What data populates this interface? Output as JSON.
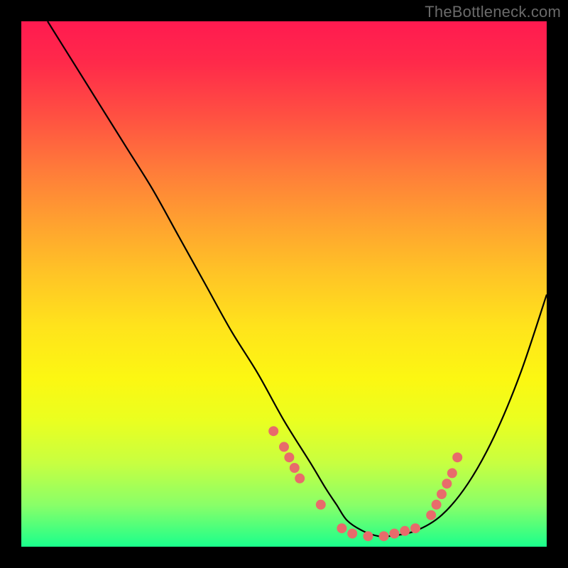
{
  "watermark": "TheBottleneck.com",
  "chart_data": {
    "type": "line",
    "title": "",
    "xlabel": "",
    "ylabel": "",
    "xlim": [
      0,
      100
    ],
    "ylim": [
      0,
      100
    ],
    "series": [
      {
        "name": "curve",
        "color": "#000000",
        "x": [
          5,
          10,
          15,
          20,
          25,
          30,
          35,
          40,
          45,
          50,
          55,
          58,
          60,
          62,
          65,
          68,
          70,
          75,
          80,
          85,
          90,
          95,
          100
        ],
        "y": [
          100,
          92,
          84,
          76,
          68,
          59,
          50,
          41,
          33,
          24,
          16,
          11,
          8,
          5,
          3,
          2,
          2,
          3,
          6,
          12,
          21,
          33,
          48
        ]
      }
    ],
    "markers": {
      "name": "highlight-points",
      "color": "#e86b6b",
      "radius": 7,
      "points": [
        {
          "x": 48,
          "y": 22
        },
        {
          "x": 50,
          "y": 19
        },
        {
          "x": 51,
          "y": 17
        },
        {
          "x": 52,
          "y": 15
        },
        {
          "x": 53,
          "y": 13
        },
        {
          "x": 57,
          "y": 8
        },
        {
          "x": 61,
          "y": 3.5
        },
        {
          "x": 63,
          "y": 2.5
        },
        {
          "x": 66,
          "y": 2
        },
        {
          "x": 69,
          "y": 2
        },
        {
          "x": 71,
          "y": 2.5
        },
        {
          "x": 73,
          "y": 3
        },
        {
          "x": 75,
          "y": 3.5
        },
        {
          "x": 78,
          "y": 6
        },
        {
          "x": 79,
          "y": 8
        },
        {
          "x": 80,
          "y": 10
        },
        {
          "x": 81,
          "y": 12
        },
        {
          "x": 82,
          "y": 14
        },
        {
          "x": 83,
          "y": 17
        }
      ]
    }
  }
}
